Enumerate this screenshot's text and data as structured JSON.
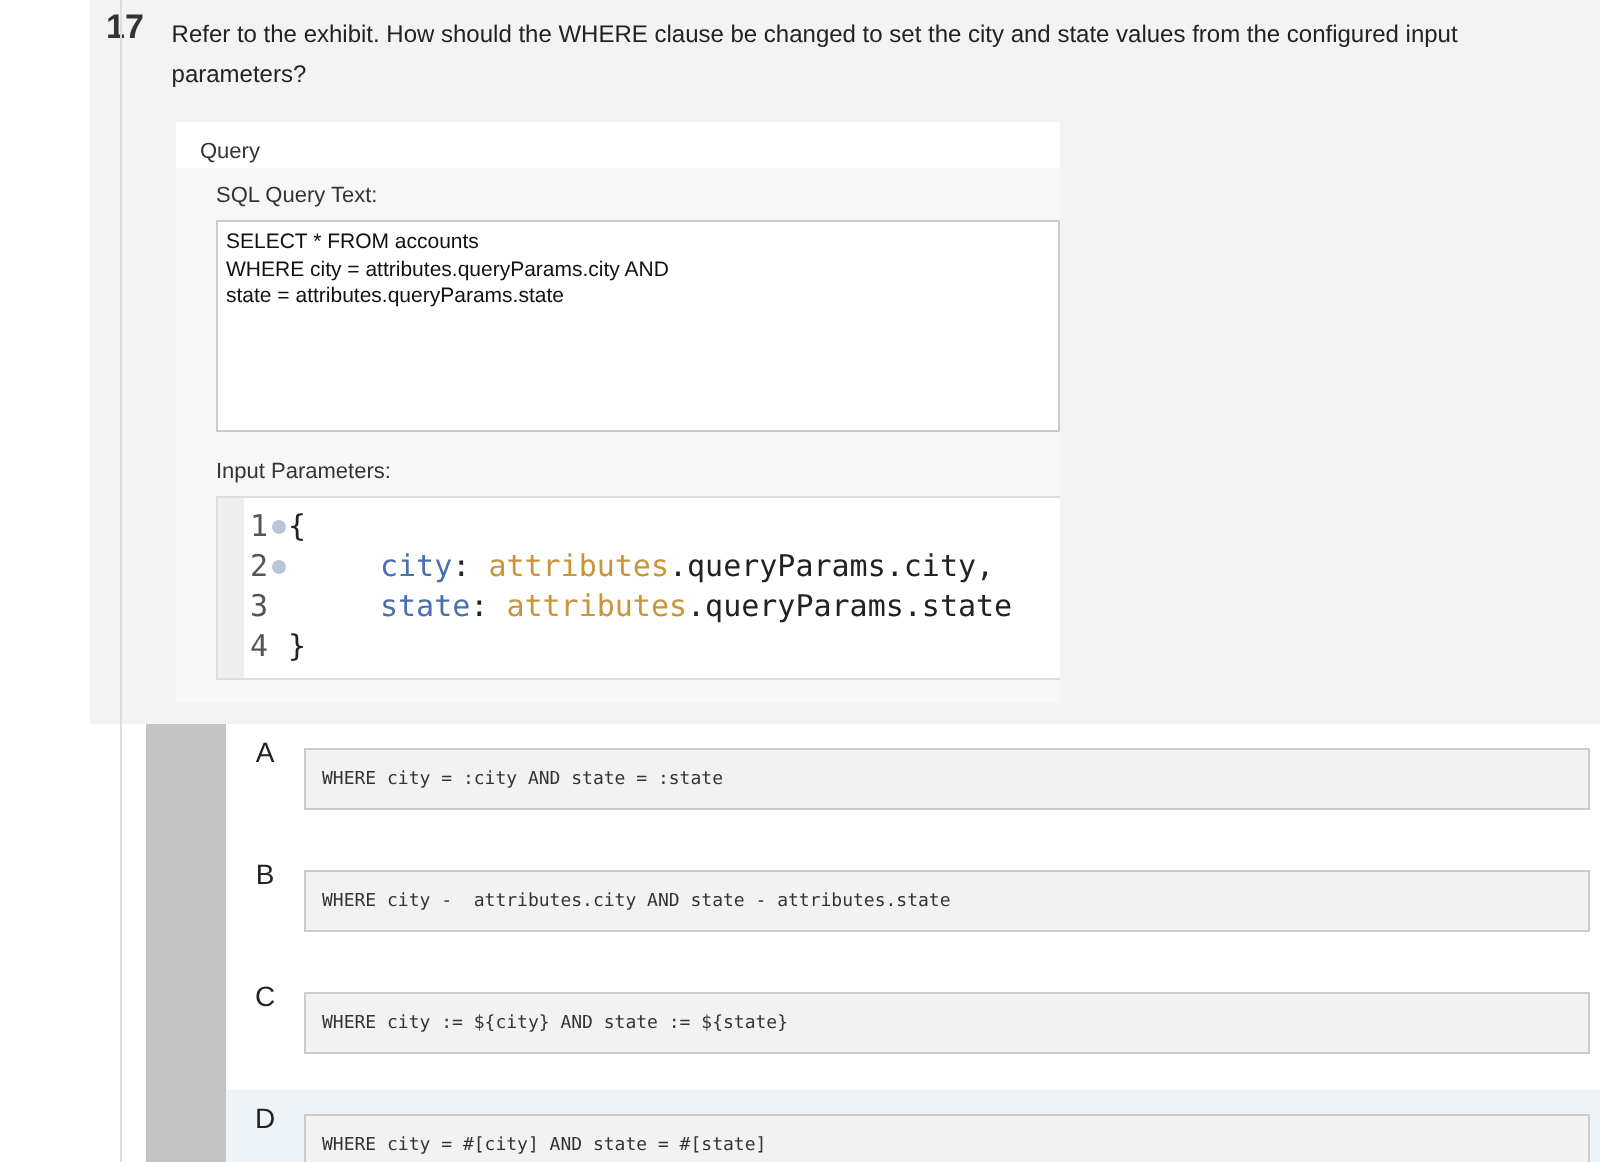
{
  "question": {
    "number": "17",
    "text": "Refer to the exhibit. How should the WHERE clause be changed to set the city and state values from the configured input parameters?"
  },
  "exhibit": {
    "title": "Query",
    "sql_label": "SQL Query Text:",
    "sql_lines": [
      "SELECT * FROM accounts",
      "WHERE city = attributes.queryParams.city AND",
      "state = attributes.queryParams.state"
    ],
    "params_label": "Input Parameters:",
    "code_lines": [
      {
        "number": "1",
        "fold": true,
        "tokens": [
          {
            "kind": "plain",
            "text": "{"
          }
        ]
      },
      {
        "number": "2",
        "fold": true,
        "tokens": [
          {
            "kind": "indent"
          },
          {
            "kind": "key",
            "text": "city"
          },
          {
            "kind": "plain",
            "text": ": "
          },
          {
            "kind": "value",
            "text": "attributes"
          },
          {
            "kind": "plain",
            "text": ".queryParams.city,"
          }
        ]
      },
      {
        "number": "3",
        "fold": false,
        "tokens": [
          {
            "kind": "indent"
          },
          {
            "kind": "key",
            "text": "state"
          },
          {
            "kind": "plain",
            "text": ": "
          },
          {
            "kind": "value",
            "text": "attributes"
          },
          {
            "kind": "plain",
            "text": ".queryParams.state"
          }
        ]
      },
      {
        "number": "4",
        "fold": false,
        "tokens": [
          {
            "kind": "plain",
            "text": "}"
          }
        ]
      }
    ]
  },
  "options": [
    {
      "letter": "A",
      "code": "WHERE city = :city AND state = :state",
      "highlighted": false
    },
    {
      "letter": "B",
      "code": "WHERE city -  attributes.city AND state - attributes.state",
      "highlighted": false
    },
    {
      "letter": "C",
      "code": "WHERE city := ${city} AND state := ${state}",
      "highlighted": false
    },
    {
      "letter": "D",
      "code": "WHERE city = #[city] AND state = #[state]",
      "highlighted": true
    }
  ]
}
